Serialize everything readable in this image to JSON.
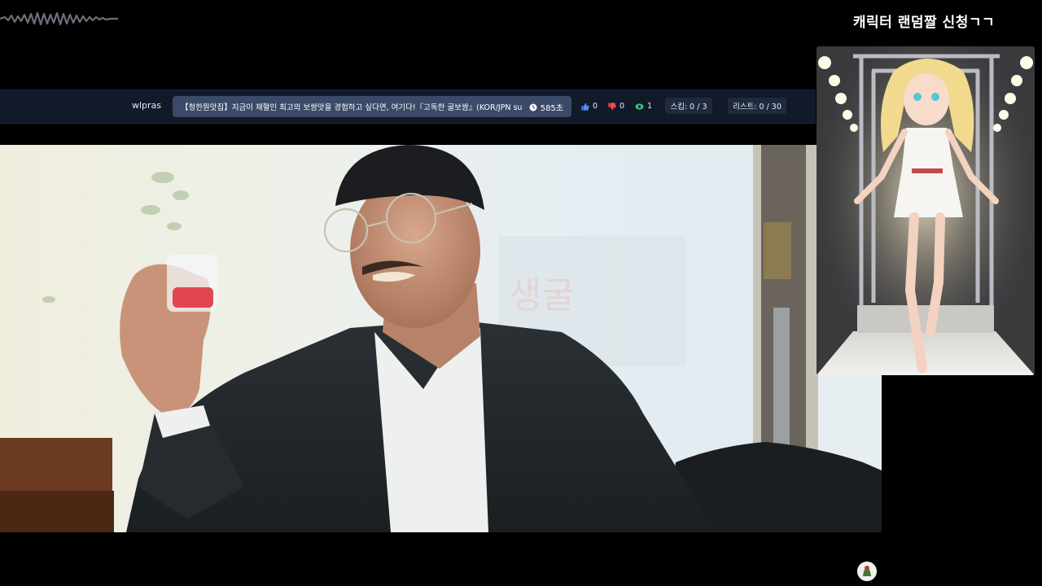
{
  "overlay": {
    "request_title": "캐릭터 랜덤짤 신청ㄱㄱ"
  },
  "request_bar": {
    "requester": "wlpras",
    "video_title": "【청한뭔맛집】지금이 채혈인 최고의 보쌈맛을 경험하고 싶다면, 여기다!『고독한 굴보쌈』(KOR/JPN sub)",
    "duration": "585초",
    "likes": "0",
    "dislikes": "0",
    "views": "1",
    "skip": "스킵: 0 / 3",
    "list": "리스트: 0 / 30"
  },
  "colors": {
    "bar_bg": "#121a2a",
    "title_chip_bg": "#3b4a68",
    "like_icon": "#4a90ff",
    "dislike_icon": "#ff4a4a",
    "view_icon": "#2fd07a"
  },
  "icons": {
    "time": "clock-icon",
    "likes": "thumbs-up-icon",
    "dislikes": "thumbs-down-icon",
    "views": "eye-icon"
  }
}
